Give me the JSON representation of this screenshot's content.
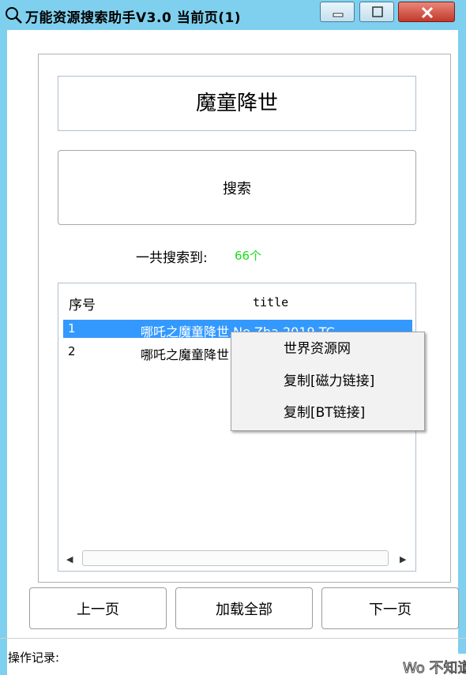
{
  "window": {
    "title": "万能资源搜索助手V3.0  当前页(1)",
    "icon": "search-icon",
    "controls": [
      "minimize-icon",
      "maximize-icon",
      "close-icon"
    ],
    "frame_color": "#7fd0ee"
  },
  "search": {
    "query_value": "魔童降世",
    "button_label": "搜索"
  },
  "result_count": {
    "label": "一共搜索到:",
    "value": "66个",
    "value_color": "#18e018"
  },
  "results": {
    "columns": [
      "序号",
      "title"
    ],
    "rows": [
      {
        "seq": "1",
        "title": "哪吒之魔童降世.Ne.Zha.2019.TC",
        "selected": true
      },
      {
        "seq": "2",
        "title": "哪吒之魔童降世",
        "selected": false
      }
    ],
    "selection_color": "#3399ff"
  },
  "context_menu": {
    "items": [
      "世界资源网",
      "复制[磁力链接]",
      "复制[BT链接]"
    ]
  },
  "pager": {
    "prev_label": "上一页",
    "load_all_label": "加载全部",
    "next_label": "下一页"
  },
  "log": {
    "label": "操作记录:"
  },
  "watermark": {
    "text": "Wo 不知道"
  }
}
